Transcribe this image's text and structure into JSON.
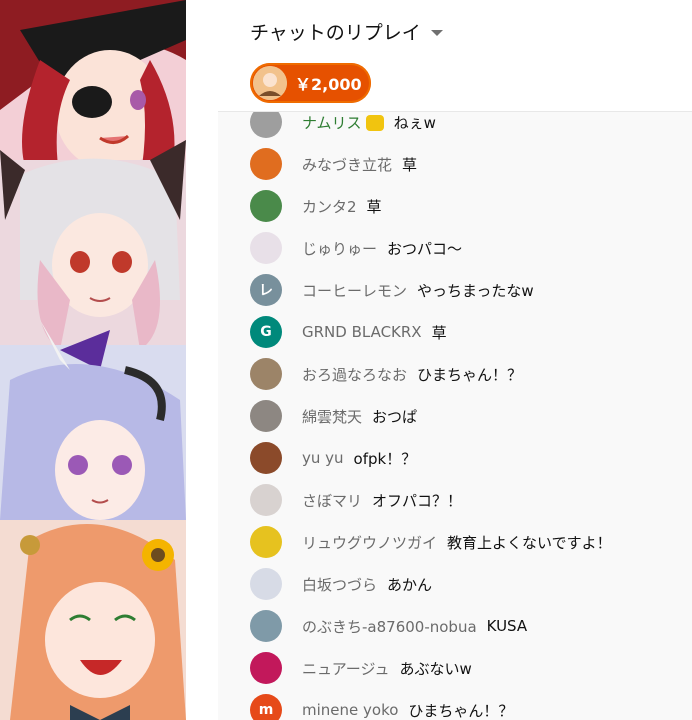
{
  "header": {
    "title": "チャットのリプレイ",
    "ticker": {
      "amount": "￥2,000"
    }
  },
  "messages": [
    {
      "author": "ナムリス",
      "text": "ねぇw",
      "avatar_color": "#9e9e9e",
      "avatar_letter": "",
      "member": true,
      "emoji": true
    },
    {
      "author": "みなづき立花",
      "text": "草",
      "avatar_color": "#e06d1f",
      "avatar_letter": ""
    },
    {
      "author": "カンタ2",
      "text": "草",
      "avatar_color": "#4a8a4a",
      "avatar_letter": ""
    },
    {
      "author": "じゅりゅー",
      "text": "おつパコ～",
      "avatar_color": "#e8e0e8",
      "avatar_letter": ""
    },
    {
      "author": "コーヒーレモン",
      "text": "やっちまったなw",
      "avatar_color": "#78909c",
      "avatar_letter": "レ"
    },
    {
      "author": "GRND BLACKRX",
      "text": "草",
      "avatar_color": "#00897b",
      "avatar_letter": "G"
    },
    {
      "author": "おろ過なろなお",
      "text": "ひまちゃん！？",
      "avatar_color": "#9c8468",
      "avatar_letter": ""
    },
    {
      "author": "綿雲梵天",
      "text": "おつぱ",
      "avatar_color": "#8d8782",
      "avatar_letter": ""
    },
    {
      "author": "yu yu",
      "text": "ofpk！？",
      "avatar_color": "#8b4a2a",
      "avatar_letter": ""
    },
    {
      "author": "さぼマリ",
      "text": "オフパコ？！",
      "avatar_color": "#d8d2d0",
      "avatar_letter": ""
    },
    {
      "author": "リュウグウノツガイ",
      "text": "教育上よくないですよ！",
      "avatar_color": "#e6c21f",
      "avatar_letter": ""
    },
    {
      "author": "白坂つづら",
      "text": "あかん",
      "avatar_color": "#d7dbe6",
      "avatar_letter": ""
    },
    {
      "author": "のぶきち-a87600-nobua",
      "text": "KUSA",
      "avatar_color": "#7f9aa8",
      "avatar_letter": ""
    },
    {
      "author": "ニュアージュ",
      "text": "あぶないw",
      "avatar_color": "#c2185b",
      "avatar_letter": ""
    },
    {
      "author": "minene yoko",
      "text": "ひまちゃん！？",
      "avatar_color": "#e64a19",
      "avatar_letter": "m"
    }
  ]
}
